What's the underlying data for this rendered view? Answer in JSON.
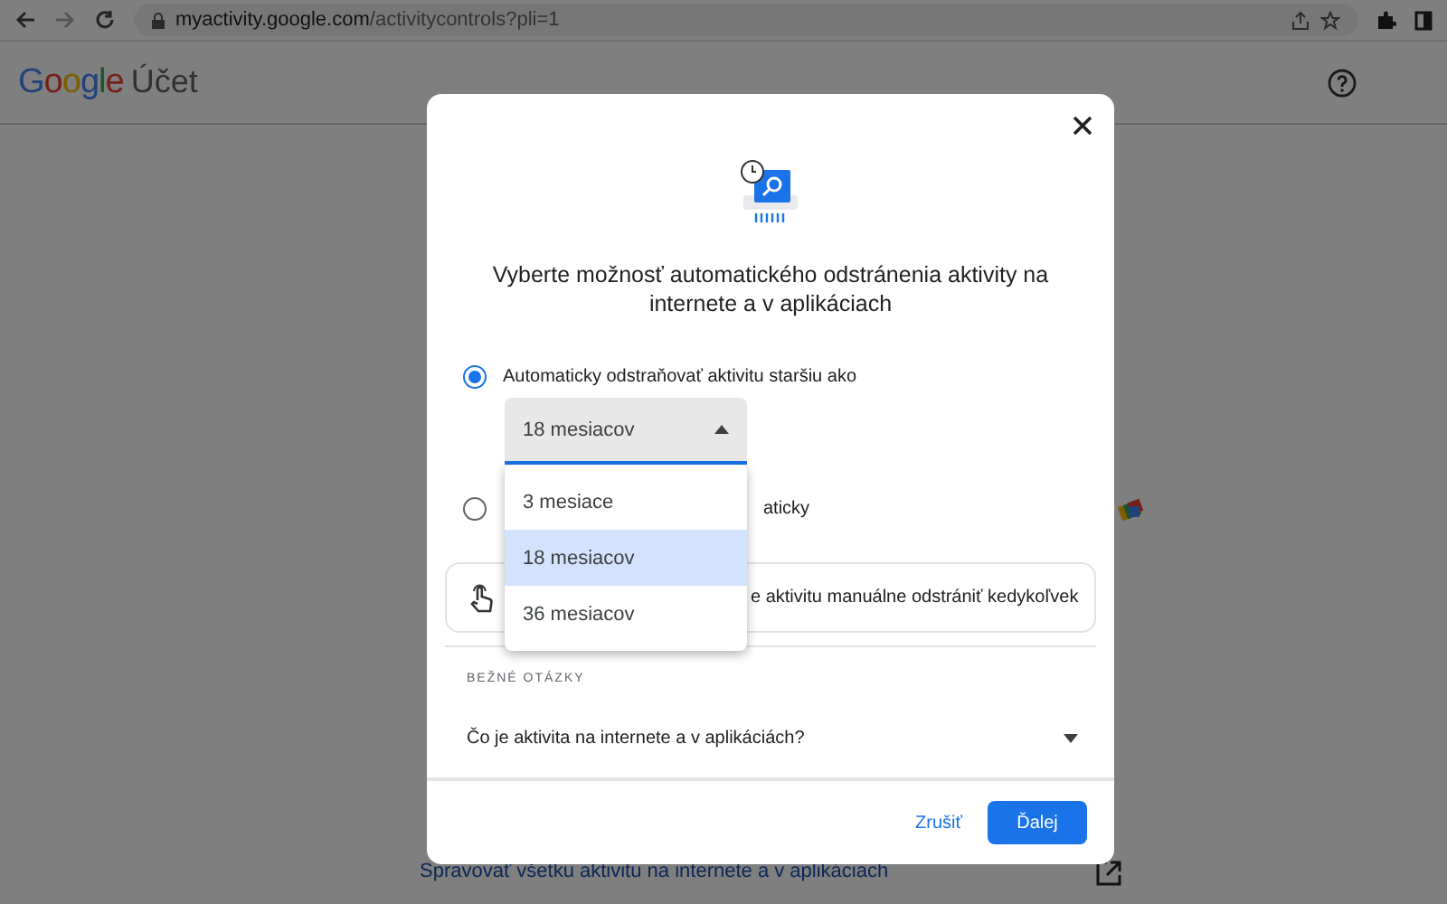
{
  "browser": {
    "url_host": "myactivity.google.com",
    "url_path": "/activitycontrols?pli=1"
  },
  "header": {
    "logo": "Google",
    "product": "Účet"
  },
  "page": {
    "manage_link": "Spravovať všetku aktivitu na internete a v aplikáciach"
  },
  "dialog": {
    "title": "Vyberte možnosť automatického odstránenia aktivity na internete a v aplikáciach",
    "options": [
      {
        "label": "Automaticky odstraňovať aktivitu staršiu ako",
        "selected": true,
        "kind": "dropdown",
        "value": "18 mesiacov"
      },
      {
        "label": "aticky",
        "selected": false,
        "kind": "plain"
      }
    ],
    "menu": [
      {
        "label": "3 mesiace",
        "selected": false
      },
      {
        "label": "18 mesiacov",
        "selected": true
      },
      {
        "label": "36 mesiacov",
        "selected": false
      }
    ],
    "info": "e aktivitu manuálne odstrániť kedykoľvek",
    "faq_heading": "BEŽNÉ OTÁZKY",
    "faq": [
      {
        "question": "Čo je aktivita na internete a v aplikáciách?",
        "expanded": false
      }
    ],
    "buttons": {
      "cancel": "Zrušiť",
      "next": "Ďalej"
    }
  }
}
